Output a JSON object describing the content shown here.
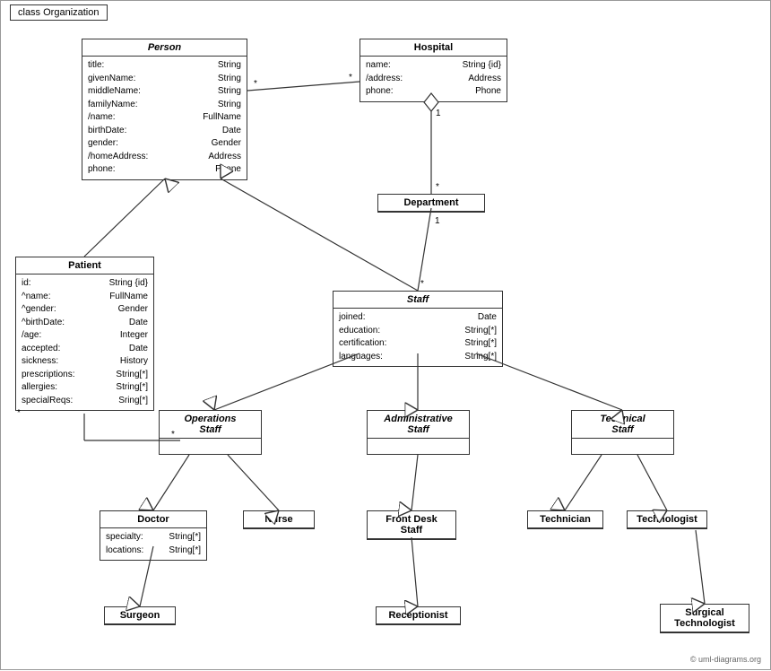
{
  "diagram": {
    "title": "class Organization",
    "copyright": "© uml-diagrams.org",
    "classes": {
      "person": {
        "name": "Person",
        "italic": true,
        "attrs": [
          [
            "title:",
            "String"
          ],
          [
            "givenName:",
            "String"
          ],
          [
            "middleName:",
            "String"
          ],
          [
            "familyName:",
            "String"
          ],
          [
            "/name:",
            "FullName"
          ],
          [
            "birthDate:",
            "Date"
          ],
          [
            "gender:",
            "Gender"
          ],
          [
            "/homeAddress:",
            "Address"
          ],
          [
            "phone:",
            "Phone"
          ]
        ]
      },
      "hospital": {
        "name": "Hospital",
        "italic": false,
        "attrs": [
          [
            "name:",
            "String {id}"
          ],
          [
            "/address:",
            "Address"
          ],
          [
            "phone:",
            "Phone"
          ]
        ]
      },
      "department": {
        "name": "Department",
        "italic": false,
        "attrs": []
      },
      "staff": {
        "name": "Staff",
        "italic": true,
        "attrs": [
          [
            "joined:",
            "Date"
          ],
          [
            "education:",
            "String[*]"
          ],
          [
            "certification:",
            "String[*]"
          ],
          [
            "languages:",
            "String[*]"
          ]
        ]
      },
      "patient": {
        "name": "Patient",
        "italic": false,
        "attrs": [
          [
            "id:",
            "String {id}"
          ],
          [
            "^name:",
            "FullName"
          ],
          [
            "^gender:",
            "Gender"
          ],
          [
            "^birthDate:",
            "Date"
          ],
          [
            "/age:",
            "Integer"
          ],
          [
            "accepted:",
            "Date"
          ],
          [
            "sickness:",
            "History"
          ],
          [
            "prescriptions:",
            "String[*]"
          ],
          [
            "allergies:",
            "String[*]"
          ],
          [
            "specialReqs:",
            "Sring[*]"
          ]
        ]
      },
      "operationsStaff": {
        "name": "Operations Staff",
        "italic": true
      },
      "administrativeStaff": {
        "name": "Administrative Staff",
        "italic": true
      },
      "technicalStaff": {
        "name": "Technical Staff",
        "italic": true
      },
      "doctor": {
        "name": "Doctor",
        "italic": false,
        "attrs": [
          [
            "specialty:",
            "String[*]"
          ],
          [
            "locations:",
            "String[*]"
          ]
        ]
      },
      "nurse": {
        "name": "Nurse",
        "italic": false,
        "attrs": []
      },
      "frontDeskStaff": {
        "name": "Front Desk Staff",
        "italic": false,
        "attrs": []
      },
      "technician": {
        "name": "Technician",
        "italic": false,
        "attrs": []
      },
      "technologist": {
        "name": "Technologist",
        "italic": false,
        "attrs": []
      },
      "surgeon": {
        "name": "Surgeon",
        "italic": false,
        "attrs": []
      },
      "receptionist": {
        "name": "Receptionist",
        "italic": false,
        "attrs": []
      },
      "surgicalTechnologist": {
        "name": "Surgical Technologist",
        "italic": false,
        "attrs": []
      }
    }
  }
}
